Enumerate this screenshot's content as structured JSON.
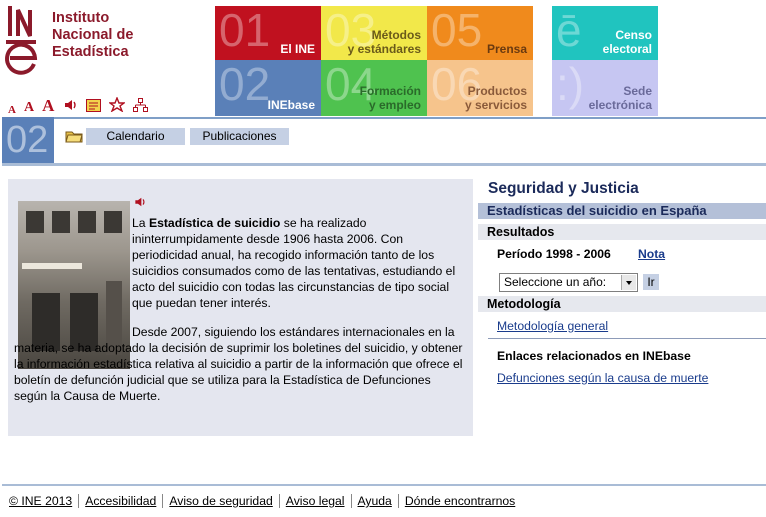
{
  "header": {
    "logo_mark": "INE",
    "logo_lines": [
      "Instituto",
      "Nacional de",
      "Estadística"
    ],
    "tools": [
      {
        "icon": "text-small-icon",
        "glyph": "A"
      },
      {
        "icon": "text-medium-icon",
        "glyph": "A"
      },
      {
        "icon": "text-large-icon",
        "glyph": "A"
      },
      {
        "icon": "speaker-icon",
        "glyph": "🔈"
      },
      {
        "icon": "newspaper-icon",
        "glyph": "▤"
      },
      {
        "icon": "star-icon",
        "glyph": "☆"
      },
      {
        "icon": "sitemap-icon",
        "glyph": "品"
      }
    ],
    "tiles": [
      {
        "num": "01",
        "label": "El INE",
        "color": "#c0111f"
      },
      {
        "num": "03",
        "label": "Métodos\ny estándares",
        "color": "#f2e84a"
      },
      {
        "num": "05",
        "label": "Prensa",
        "color": "#f08a1c"
      },
      {
        "num": "02",
        "label": "INEbase",
        "color": "#5a80b8"
      },
      {
        "num": "04",
        "label": "Formación\ny empleo",
        "color": "#4fc24f"
      },
      {
        "num": "06",
        "label": "Productos\ny servicios",
        "color": "#f6c48c"
      },
      {
        "num": "ē",
        "label": "Censo\nelectoral",
        "color": "#20c4bf"
      },
      {
        "num": ":)",
        "label": "Sede\nelectrónica",
        "color": "#c6c6f2"
      }
    ]
  },
  "subnav": {
    "tag": "02",
    "icon": "folder-icon",
    "buttons": [
      "Calendario",
      "Publicaciones"
    ]
  },
  "main": {
    "para1_pre": "La ",
    "para1_bold": "Estadística de suicidio",
    "para1_post": " se ha realizado ininterrumpidamente desde 1906 hasta 2006. Con periodicidad anual, ha recogido información tanto de los suicidios consumados como de las tentativas, estudiando el acto del suicidio con todas las circunstancias de tipo social que puedan tener interés.",
    "para2": "Desde 2007, siguiendo los estándares internacionales en la materia, se ha adoptado la decisión de suprimir los boletines del suicidio, y obtener la información estadística relativa al suicidio a partir de la información que ofrece el boletín de defunción judicial que se utiliza para la Estadística de Defunciones según la Causa de Muerte."
  },
  "side": {
    "title": "Seguridad y Justicia",
    "heading": "Estadísticas del suicidio en España",
    "results_label": "Resultados",
    "period": "Período 1998 - 2006",
    "nota": "Nota",
    "select_value": "Seleccione un año:",
    "go": "Ir",
    "method_label": "Metodología",
    "method_link": "Metodología general",
    "related_label": "Enlaces relacionados en INEbase",
    "related_link": "Defunciones según la causa de muerte"
  },
  "footer": {
    "links": [
      "© INE 2013",
      "Accesibilidad",
      "Aviso de seguridad",
      "Aviso legal",
      "Ayuda",
      "Dónde encontrarnos"
    ]
  }
}
